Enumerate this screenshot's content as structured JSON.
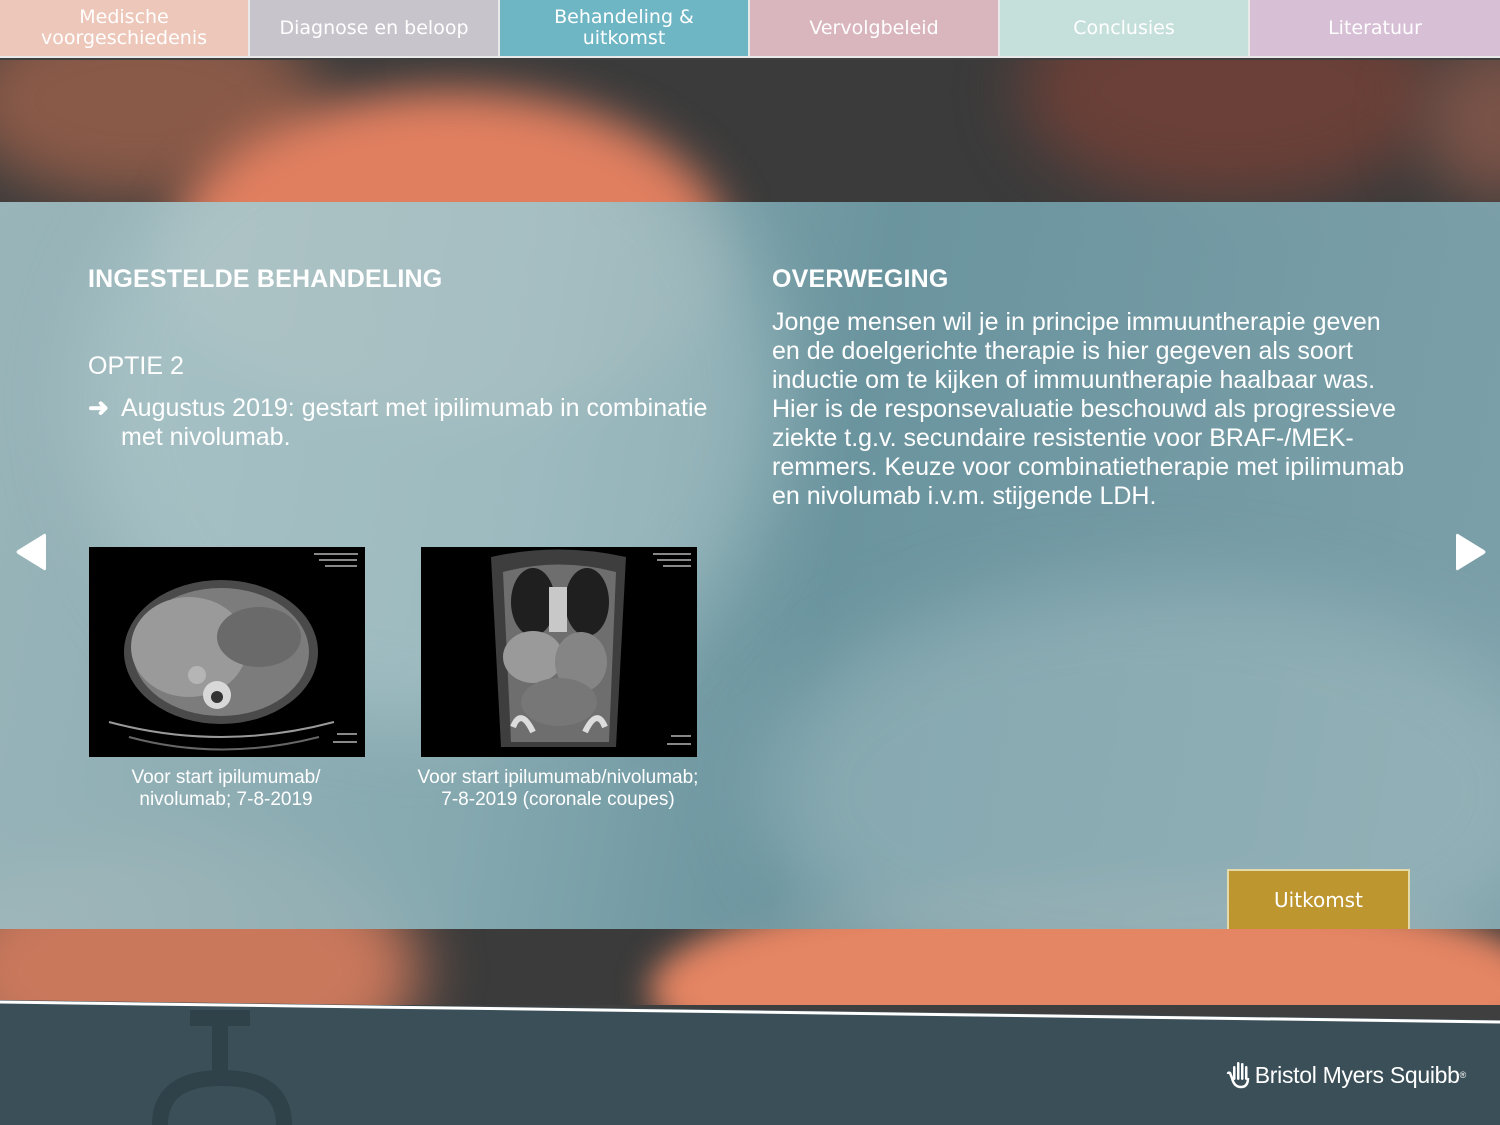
{
  "nav": {
    "tabs": [
      {
        "label": "Medische voorgeschiedenis",
        "color": "#edc7b9",
        "active": false
      },
      {
        "label": "Diagnose en beloop",
        "color": "#c8c4cb",
        "active": false
      },
      {
        "label": "Behandeling & uitkomst",
        "color": "#6fb6c4",
        "active": true
      },
      {
        "label": "Vervolgbeleid",
        "color": "#d9b6bd",
        "active": false
      },
      {
        "label": "Conclusies",
        "color": "#c5dfdb",
        "active": false
      },
      {
        "label": "Literatuur",
        "color": "#d7bfd6",
        "active": false
      }
    ]
  },
  "left": {
    "heading": "INGESTELDE BEHANDELING",
    "option": "OPTIE 2",
    "bullet_icon": "arrow-right-icon",
    "bullet_text": "Augustus 2019: gestart met ipilimumab in combinatie met nivolumab.",
    "images": [
      {
        "icon": "ct-scan-axial",
        "caption_line1": "Voor start ipilumumab/",
        "caption_line2": "nivolumab; 7-8-2019"
      },
      {
        "icon": "ct-scan-coronal",
        "caption_line1": "Voor start ipilumumab/nivolumab;",
        "caption_line2": "7-8-2019 (coronale coupes)"
      }
    ]
  },
  "right": {
    "heading": "OVERWEGING",
    "text": "Jonge mensen wil je in principe immuuntherapie geven en de doelgerichte therapie is hier gegeven als soort inductie om te kijken of immuuntherapie haalbaar was. Hier is de responsevaluatie beschouwd als progressieve ziekte t.g.v. secundaire resistentie voor BRAF-/MEK-remmers. Keuze voor combinatietherapie met ipilimumab en nivolumab i.v.m. stijgende LDH."
  },
  "outcome_button": {
    "label": "Uitkomst",
    "color": "#bd962f"
  },
  "navigation": {
    "prev_icon": "triangle-left-icon",
    "next_icon": "triangle-right-icon"
  },
  "footer": {
    "brand": "Bristol Myers Squibb",
    "brand_mark": "®",
    "logo_icon": "bms-hand-icon",
    "color": "#3a4f57"
  }
}
